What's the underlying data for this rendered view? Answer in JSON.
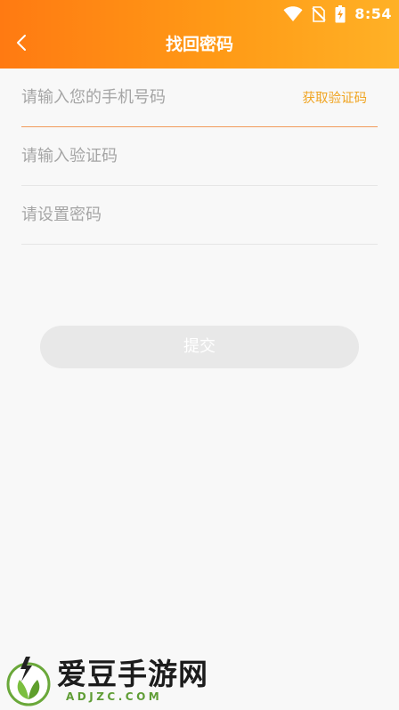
{
  "status_bar": {
    "time": "8:54",
    "icons": [
      "wifi-icon",
      "no-sim-icon",
      "battery-charging-icon"
    ]
  },
  "header": {
    "title": "找回密码",
    "back_icon": "chevron-left-icon"
  },
  "form": {
    "phone_placeholder": "请输入您的手机号码",
    "get_code_label": "获取验证码",
    "code_placeholder": "请输入验证码",
    "password_placeholder": "请设置密码"
  },
  "submit_label": "提交",
  "watermark": {
    "name": "爱豆手游网",
    "domain": "ADJZC.COM"
  },
  "colors": {
    "header_start": "#ff7a12",
    "header_end": "#ffb126",
    "accent": "#f0a421",
    "active_underline": "#f29a5b",
    "button_disabled": "#e8e8e8",
    "logo_green": "#5f9d35"
  }
}
